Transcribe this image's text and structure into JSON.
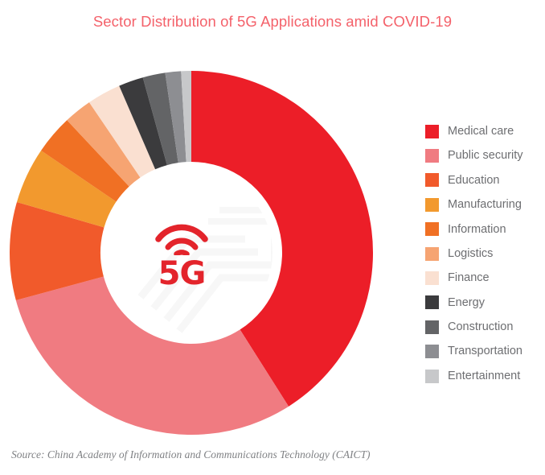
{
  "chart_data": {
    "type": "pie",
    "variant": "donut",
    "title": "Sector Distribution of 5G Applications amid COVID-19",
    "source": "Source: China Academy of Information and Communications Technology (CAICT)",
    "center_label": "5G",
    "center_icon": "wifi-signal-icon",
    "legend_position": "right",
    "start_angle_deg": 0,
    "direction": "clockwise",
    "categories": [
      "Medical care",
      "Public security",
      "Education",
      "Manufacturing",
      "Information",
      "Logistics",
      "Finance",
      "Energy",
      "Construction",
      "Transportation",
      "Entertainment"
    ],
    "values": [
      41.0,
      29.8,
      8.7,
      5.0,
      3.5,
      2.5,
      3.0,
      2.2,
      2.0,
      1.4,
      0.9
    ],
    "unit": "percent",
    "colors": [
      "#ec1e28",
      "#f07b81",
      "#f15a2b",
      "#f2992e",
      "#f07024",
      "#f6a472",
      "#fae0d1",
      "#3b3b3d",
      "#636466",
      "#8d8e92",
      "#c7c8ca"
    ],
    "slices": [
      {
        "label": "Medical care",
        "value": 41.0,
        "color": "#ec1e28"
      },
      {
        "label": "Public security",
        "value": 29.8,
        "color": "#f07b81"
      },
      {
        "label": "Education",
        "value": 8.7,
        "color": "#f15a2b"
      },
      {
        "label": "Manufacturing",
        "value": 5.0,
        "color": "#f2992e"
      },
      {
        "label": "Information",
        "value": 3.5,
        "color": "#f07024"
      },
      {
        "label": "Logistics",
        "value": 2.5,
        "color": "#f6a472"
      },
      {
        "label": "Finance",
        "value": 3.0,
        "color": "#fae0d1"
      },
      {
        "label": "Energy",
        "value": 2.2,
        "color": "#3b3b3d"
      },
      {
        "label": "Construction",
        "value": 2.0,
        "color": "#636466"
      },
      {
        "label": "Transportation",
        "value": 1.4,
        "color": "#8d8e92"
      },
      {
        "label": "Entertainment",
        "value": 0.9,
        "color": "#c7c8ca"
      }
    ]
  },
  "title": "Sector Distribution of 5G Applications amid COVID-19",
  "center": {
    "text": "5G",
    "icon": "wifi-signal-icon"
  },
  "legend": {
    "items": [
      {
        "label": "Medical care",
        "color": "#ec1e28"
      },
      {
        "label": "Public security",
        "color": "#f07b81"
      },
      {
        "label": "Education",
        "color": "#f15a2b"
      },
      {
        "label": "Manufacturing",
        "color": "#f2992e"
      },
      {
        "label": "Information",
        "color": "#f07024"
      },
      {
        "label": "Logistics",
        "color": "#f6a472"
      },
      {
        "label": "Finance",
        "color": "#fae0d1"
      },
      {
        "label": "Energy",
        "color": "#3b3b3d"
      },
      {
        "label": "Construction",
        "color": "#636466"
      },
      {
        "label": "Transportation",
        "color": "#8d8e92"
      },
      {
        "label": "Entertainment",
        "color": "#c7c8ca"
      }
    ]
  },
  "source": "Source: China Academy of Information and Communications Technology (CAICT)",
  "theme": {
    "title_color": "#f4616a",
    "legend_text_color": "#6d6e71",
    "source_color": "#808285",
    "background": "#ffffff",
    "logo_color": "#e3242b"
  }
}
